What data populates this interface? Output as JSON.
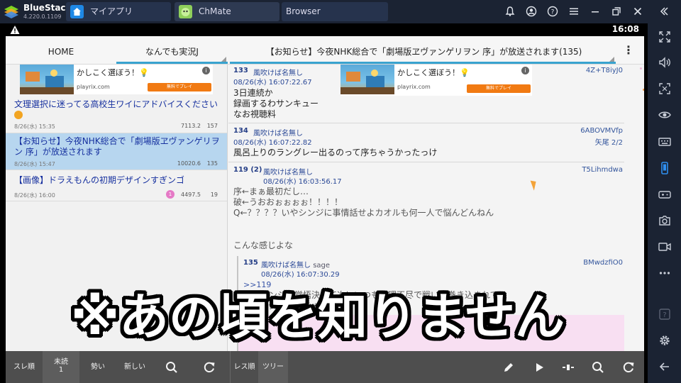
{
  "bluestacks": {
    "brand": "BlueStacks",
    "version": "4.220.0.1109",
    "tabs": [
      {
        "label": "マイアプリ",
        "icon": "home-icon"
      },
      {
        "label": "ChMate",
        "icon": "chmate-app-icon"
      },
      {
        "label": "Browser",
        "icon": ""
      }
    ],
    "window_controls": [
      "bell-icon",
      "user-icon",
      "help-icon",
      "menu-icon",
      "minimize-icon",
      "restore-icon",
      "close-icon",
      "back-chevrons-icon"
    ],
    "sidebar_icons": [
      "fullscreen-icon",
      "volume-icon",
      "screenshot-region-icon",
      "eye-icon",
      "keyboard-icon",
      "phone-icon",
      "gamepad-icon",
      "camera-icon",
      "record-icon",
      "more-icon",
      "help-icon",
      "settings-icon",
      "back-arrow-icon"
    ]
  },
  "status_bar": {
    "time": "16:08"
  },
  "app": {
    "tabs": {
      "home": "HOME",
      "board": "なんでも実況J",
      "thread": "【お知らせ】今夜NHK総合で「劇場版ヱヴァンゲリヲン 序」が放送されます(135)"
    },
    "ad": {
      "headline": "かしこく選ぼう！",
      "bulb": "💡",
      "domain": "playrix.com",
      "cta": "無料でプレイ",
      "info": "i"
    },
    "threads": [
      {
        "title": "文理選択に迷ってる高校生ワイにアドバイスください",
        "date": "8/26(水) 15:35",
        "speed": "7113.2",
        "count": "157"
      },
      {
        "title": "【お知らせ】今夜NHK総合で「劇場版ヱヴァンゲリヲン 序」が放送されます",
        "date": "8/26(水) 15:47",
        "speed": "10020.6",
        "count": "135"
      },
      {
        "title": "【画像】ドラえもんの初期デザインすぎンゴ",
        "date": "8/26(水) 16:00",
        "unread": "1",
        "speed": "4497.5",
        "count": "19"
      }
    ],
    "posts": [
      {
        "num": "133",
        "name": "風吹けば名無し",
        "date": "08/26(水) 16:07:22.67",
        "id": "4Z+T8iyJ0",
        "text": "3日連続か\n録画するわサンキュー\nなお視聴料"
      },
      {
        "num": "134",
        "name": "風吹けば名無し",
        "date": "08/26(水) 16:07:22.82",
        "id": "6ABOVMVfp",
        "id2": "矢尾 2/2",
        "text": "風呂上りのラングレー出るのって序ちゃうかったっけ"
      },
      {
        "num": "119 (2)",
        "name": "風吹けば名無し",
        "date": "08/26(水) 16:03:56.17",
        "id": "T5Lihmdwa",
        "text": "序←まぁ最初だし…\n破←うおおぉぉぉぉ！！！！\nQ←？？？？いやシンジに事情話せよカオルも何一人で悩んどんねん",
        "text2": "こんな感じよな"
      },
      {
        "num": "135",
        "name": "風吹けば名無し",
        "sage": "sage",
        "date": "08/26(水) 16:07:30.29",
        "id": "BMwdzfiO0",
        "anchor": ">>119",
        "text": "序でシンジが覚悟決めて次にいつもの理不尽で戦いに巻き込まれて\n使徒を倒した後ちゃうか"
      }
    ],
    "bottom_bar": {
      "left_buttons": [
        "スレ順",
        "未読",
        "勢い",
        "新しい"
      ],
      "unread_count": "1",
      "right_buttons": [
        "レス順",
        "ツリー"
      ]
    }
  },
  "caption": "※あの頃を知りません",
  "colors": {
    "accent": "#39a3cf",
    "link": "#16309f",
    "selected": "#b7d6ef",
    "cta": "#f17a12"
  }
}
